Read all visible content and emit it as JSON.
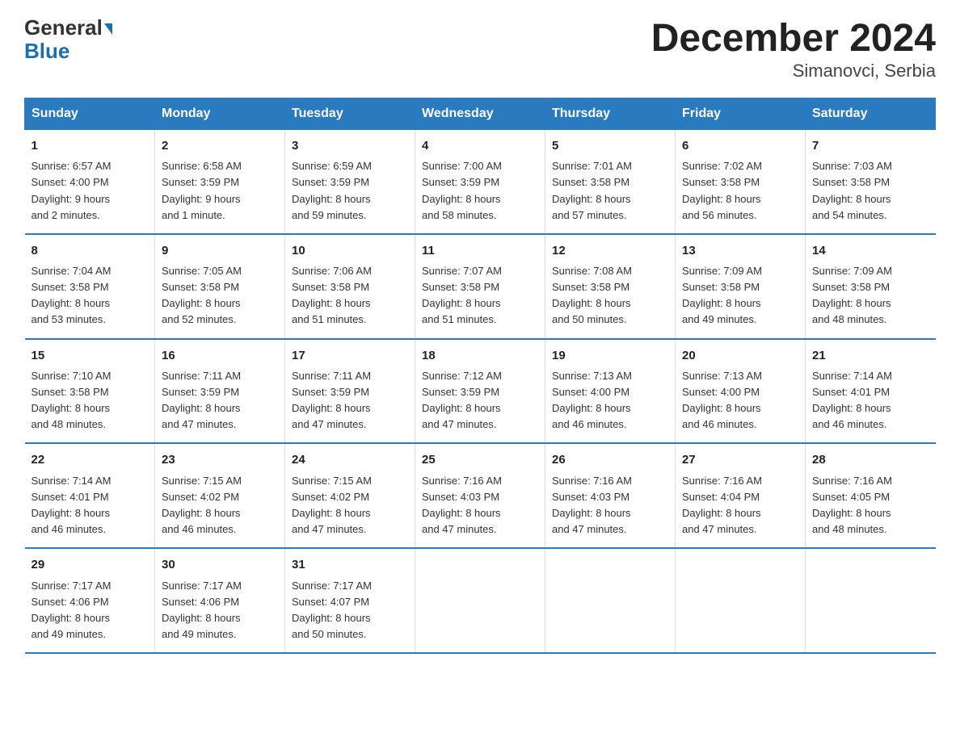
{
  "header": {
    "logo_general": "General",
    "logo_blue": "Blue",
    "title": "December 2024",
    "subtitle": "Simanovci, Serbia"
  },
  "days_of_week": [
    "Sunday",
    "Monday",
    "Tuesday",
    "Wednesday",
    "Thursday",
    "Friday",
    "Saturday"
  ],
  "weeks": [
    [
      {
        "num": "1",
        "info": "Sunrise: 6:57 AM\nSunset: 4:00 PM\nDaylight: 9 hours\nand 2 minutes."
      },
      {
        "num": "2",
        "info": "Sunrise: 6:58 AM\nSunset: 3:59 PM\nDaylight: 9 hours\nand 1 minute."
      },
      {
        "num": "3",
        "info": "Sunrise: 6:59 AM\nSunset: 3:59 PM\nDaylight: 8 hours\nand 59 minutes."
      },
      {
        "num": "4",
        "info": "Sunrise: 7:00 AM\nSunset: 3:59 PM\nDaylight: 8 hours\nand 58 minutes."
      },
      {
        "num": "5",
        "info": "Sunrise: 7:01 AM\nSunset: 3:58 PM\nDaylight: 8 hours\nand 57 minutes."
      },
      {
        "num": "6",
        "info": "Sunrise: 7:02 AM\nSunset: 3:58 PM\nDaylight: 8 hours\nand 56 minutes."
      },
      {
        "num": "7",
        "info": "Sunrise: 7:03 AM\nSunset: 3:58 PM\nDaylight: 8 hours\nand 54 minutes."
      }
    ],
    [
      {
        "num": "8",
        "info": "Sunrise: 7:04 AM\nSunset: 3:58 PM\nDaylight: 8 hours\nand 53 minutes."
      },
      {
        "num": "9",
        "info": "Sunrise: 7:05 AM\nSunset: 3:58 PM\nDaylight: 8 hours\nand 52 minutes."
      },
      {
        "num": "10",
        "info": "Sunrise: 7:06 AM\nSunset: 3:58 PM\nDaylight: 8 hours\nand 51 minutes."
      },
      {
        "num": "11",
        "info": "Sunrise: 7:07 AM\nSunset: 3:58 PM\nDaylight: 8 hours\nand 51 minutes."
      },
      {
        "num": "12",
        "info": "Sunrise: 7:08 AM\nSunset: 3:58 PM\nDaylight: 8 hours\nand 50 minutes."
      },
      {
        "num": "13",
        "info": "Sunrise: 7:09 AM\nSunset: 3:58 PM\nDaylight: 8 hours\nand 49 minutes."
      },
      {
        "num": "14",
        "info": "Sunrise: 7:09 AM\nSunset: 3:58 PM\nDaylight: 8 hours\nand 48 minutes."
      }
    ],
    [
      {
        "num": "15",
        "info": "Sunrise: 7:10 AM\nSunset: 3:58 PM\nDaylight: 8 hours\nand 48 minutes."
      },
      {
        "num": "16",
        "info": "Sunrise: 7:11 AM\nSunset: 3:59 PM\nDaylight: 8 hours\nand 47 minutes."
      },
      {
        "num": "17",
        "info": "Sunrise: 7:11 AM\nSunset: 3:59 PM\nDaylight: 8 hours\nand 47 minutes."
      },
      {
        "num": "18",
        "info": "Sunrise: 7:12 AM\nSunset: 3:59 PM\nDaylight: 8 hours\nand 47 minutes."
      },
      {
        "num": "19",
        "info": "Sunrise: 7:13 AM\nSunset: 4:00 PM\nDaylight: 8 hours\nand 46 minutes."
      },
      {
        "num": "20",
        "info": "Sunrise: 7:13 AM\nSunset: 4:00 PM\nDaylight: 8 hours\nand 46 minutes."
      },
      {
        "num": "21",
        "info": "Sunrise: 7:14 AM\nSunset: 4:01 PM\nDaylight: 8 hours\nand 46 minutes."
      }
    ],
    [
      {
        "num": "22",
        "info": "Sunrise: 7:14 AM\nSunset: 4:01 PM\nDaylight: 8 hours\nand 46 minutes."
      },
      {
        "num": "23",
        "info": "Sunrise: 7:15 AM\nSunset: 4:02 PM\nDaylight: 8 hours\nand 46 minutes."
      },
      {
        "num": "24",
        "info": "Sunrise: 7:15 AM\nSunset: 4:02 PM\nDaylight: 8 hours\nand 47 minutes."
      },
      {
        "num": "25",
        "info": "Sunrise: 7:16 AM\nSunset: 4:03 PM\nDaylight: 8 hours\nand 47 minutes."
      },
      {
        "num": "26",
        "info": "Sunrise: 7:16 AM\nSunset: 4:03 PM\nDaylight: 8 hours\nand 47 minutes."
      },
      {
        "num": "27",
        "info": "Sunrise: 7:16 AM\nSunset: 4:04 PM\nDaylight: 8 hours\nand 47 minutes."
      },
      {
        "num": "28",
        "info": "Sunrise: 7:16 AM\nSunset: 4:05 PM\nDaylight: 8 hours\nand 48 minutes."
      }
    ],
    [
      {
        "num": "29",
        "info": "Sunrise: 7:17 AM\nSunset: 4:06 PM\nDaylight: 8 hours\nand 49 minutes."
      },
      {
        "num": "30",
        "info": "Sunrise: 7:17 AM\nSunset: 4:06 PM\nDaylight: 8 hours\nand 49 minutes."
      },
      {
        "num": "31",
        "info": "Sunrise: 7:17 AM\nSunset: 4:07 PM\nDaylight: 8 hours\nand 50 minutes."
      },
      null,
      null,
      null,
      null
    ]
  ]
}
